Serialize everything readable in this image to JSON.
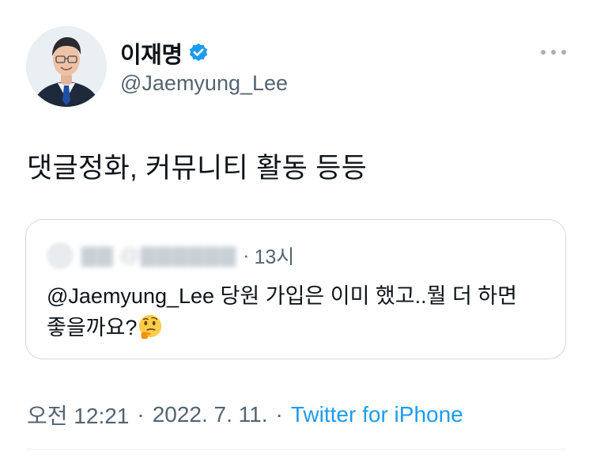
{
  "tweet": {
    "author": {
      "display_name": "이재명",
      "handle": "@Jaemyung_Lee",
      "verified": true
    },
    "text": "댓글정화, 커뮤니티 활동 등등",
    "quoted": {
      "time": "13시",
      "separator": "·",
      "mention": "@Jaemyung_Lee",
      "body_line1": " 당원 가입은 이미 했고..뭘 더 하면",
      "body_line2": "좋을까요?"
    },
    "meta": {
      "time": "오전 12:21",
      "separator1": "·",
      "date": "2022. 7. 11.",
      "separator2": "·",
      "source": "Twitter for iPhone"
    }
  },
  "icons": {
    "verified": "verified-badge-icon",
    "more": "more-horizontal-icon",
    "emoji": "thinking-face-emoji"
  },
  "colors": {
    "text": "#0f1419",
    "secondary": "#536471",
    "link": "#1d9bf0",
    "border": "#cfd9de"
  }
}
